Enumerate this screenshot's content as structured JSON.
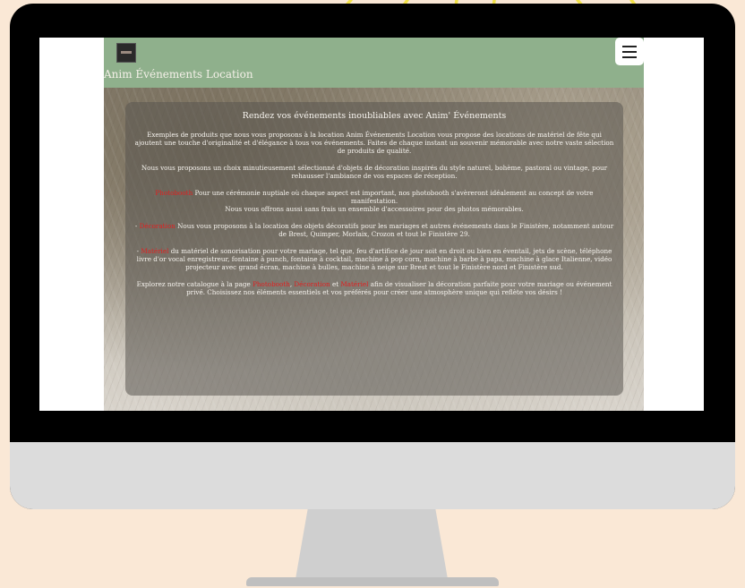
{
  "site": {
    "brand": "Anim Événements Location",
    "heading": "Rendez vos événements inoubliables avec Anim' Événements",
    "para1": "Exemples de produits que nous vous proposons à la location Anim Événements Location vous propose des locations de matériel de fête qui ajoutent une touche d'originalité et d'élégance à tous vos événements. Faites de chaque instant un souvenir mémorable avec notre vaste sélection de produits de qualité.",
    "para2": "Nous vous proposons un choix minutieusement sélectionné d'objets de décoration inspirés du style naturel, bohème, pastoral ou vintage, pour rehausser l'ambiance de vos espaces de réception.",
    "para3_link": "Photobooth",
    "para3_text": " Pour une cérémonie nuptiale où chaque aspect est important, nos photobooth s'avèreront idéalement au concept de votre manifestation.",
    "para3_line2": "Nous vous offrons aussi sans frais un ensemble d'accessoires pour des photos mémorables.",
    "para4_prefix": "- ",
    "para4_link": "Décoration",
    "para4_text": " Nous vous proposons à la location des objets décoratifs pour les mariages et autres événements dans le Finistère, notamment autour de Brest, Quimper, Morlaix, Crozon et tout le Finistère 29.",
    "para5_prefix": "- ",
    "para5_link": "Matériel",
    "para5_text": " du matériel de sonorisation pour votre mariage, tel que, feu d'artifice de jour soit en droit ou bien en éventail, jets de scène, téléphone livre d'or vocal enregistreur, fontaine à punch, fontaine à cocktail, machine à pop corn, machine à barbe à papa, machine à glace Italienne, vidéo projecteur avec grand écran, machine à bulles, machine à neige sur Brest et tout le Finistère nord et Finistère sud.",
    "para6_a": "Explorez notre catalogue à la page ",
    "para6_link1": "Photobooth",
    "para6_sep": ", ",
    "para6_link2": "Décoration",
    "para6_and": " et ",
    "para6_link3": "Matériel",
    "para6_b": " afin de visualiser la décoration parfaite pour votre mariage ou événement privé. Choisissez nos éléments essentiels et vos préférés pour créer une atmosphère unique qui reflète vos désirs !"
  },
  "icons": {
    "menu": "hamburger-menu-icon",
    "logo": "brand-logo"
  },
  "colors": {
    "navbar": "#8fb08c",
    "background": "#fae8d6",
    "link": "#e02020",
    "rays": "#f2e24a"
  }
}
